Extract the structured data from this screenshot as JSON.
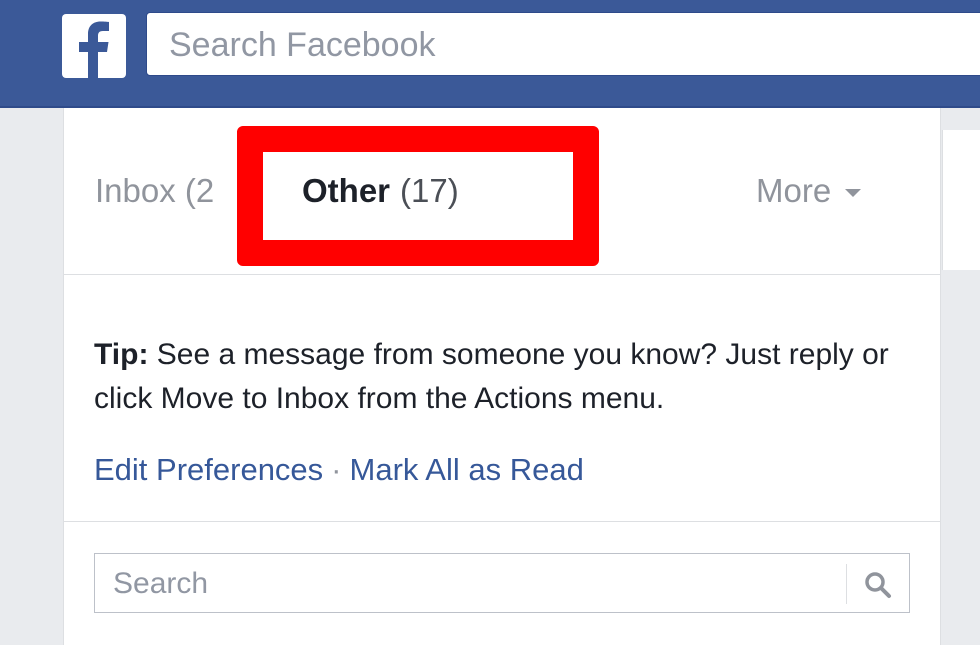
{
  "header": {
    "logo_icon": "facebook-f-icon",
    "search_placeholder": "Search Facebook"
  },
  "tabs": {
    "inbox_label": "Inbox (2",
    "other_label": "Other",
    "other_count": "(17)",
    "more_label": "More"
  },
  "tip": {
    "prefix": "Tip:",
    "text": " See a message from someone you know? Just reply or click Move to Inbox from the Actions menu."
  },
  "links": {
    "edit_preferences": "Edit Preferences",
    "separator": "·",
    "mark_all_read": "Mark All as Read"
  },
  "message_search": {
    "placeholder": "Search",
    "icon": "search-icon"
  },
  "colors": {
    "brand": "#3b5998",
    "highlight": "#ff0000",
    "link": "#365899"
  }
}
